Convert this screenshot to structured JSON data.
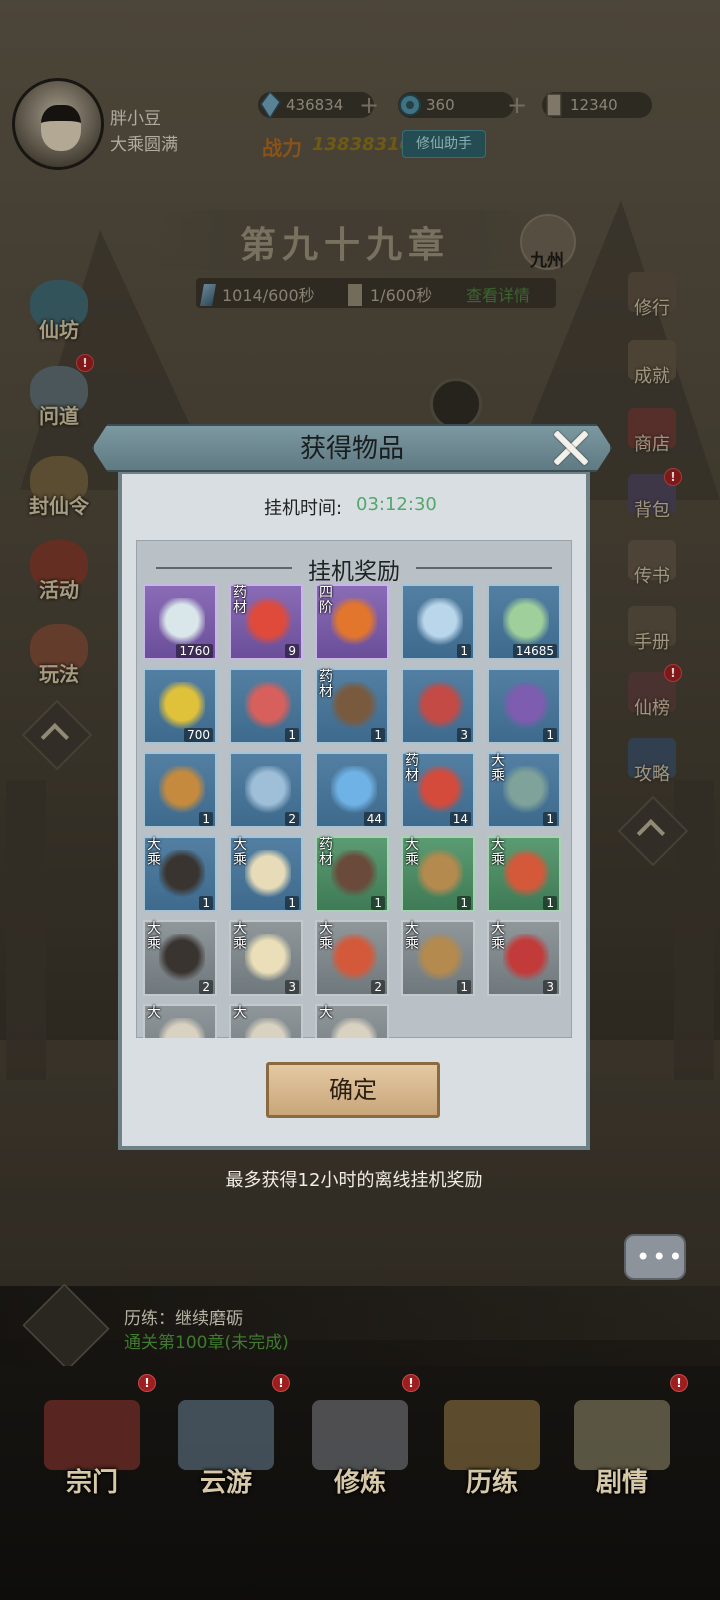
{
  "player": {
    "name": "胖小豆",
    "rank": "大乘圆满",
    "power_label": "战力",
    "power_value": "13838310",
    "helper_button": "修仙助手"
  },
  "resources": [
    {
      "name": "spirit-stone",
      "value": "436834"
    },
    {
      "name": "jade",
      "value": "360"
    },
    {
      "name": "scroll",
      "value": "12340"
    }
  ],
  "chapter": {
    "title": "第九十九章",
    "region": "九州",
    "rate_stone": "1014/600秒",
    "rate_scroll": "1/600秒",
    "details_link": "查看详情"
  },
  "left_menu": [
    {
      "label": "仙坊",
      "badge": ""
    },
    {
      "label": "问道",
      "badge": "!"
    },
    {
      "label": "封仙令",
      "badge": ""
    },
    {
      "label": "活动",
      "badge": ""
    },
    {
      "label": "玩法",
      "badge": ""
    }
  ],
  "right_menu": [
    {
      "label": "修行",
      "badge": ""
    },
    {
      "label": "成就",
      "badge": ""
    },
    {
      "label": "商店",
      "badge": ""
    },
    {
      "label": "背包",
      "badge": "!"
    },
    {
      "label": "传书",
      "badge": ""
    },
    {
      "label": "手册",
      "badge": ""
    },
    {
      "label": "仙榜",
      "badge": "!"
    },
    {
      "label": "攻略",
      "badge": ""
    }
  ],
  "modal": {
    "title": "获得物品",
    "idle_label": "挂机时间:",
    "idle_value": "03:12:30",
    "reward_heading": "挂机奖励",
    "confirm": "确定",
    "note": "最多获得12小时的离线挂机奖励"
  },
  "items": [
    {
      "icon": "spirit-orb-icon",
      "tag": "",
      "qty": "1760",
      "rarity": "purple",
      "color": "#d9e6ea"
    },
    {
      "icon": "fire-herb-icon",
      "tag": "药材",
      "qty": "9",
      "rarity": "purple",
      "color": "#e04a3a"
    },
    {
      "icon": "fire-rune-icon",
      "tag": "四阶",
      "qty": "",
      "rarity": "purple",
      "color": "#e3762d"
    },
    {
      "icon": "blue-crystal-icon",
      "tag": "",
      "qty": "1",
      "rarity": "blue",
      "color": "#b9d6ea"
    },
    {
      "icon": "green-swirl-icon",
      "tag": "",
      "qty": "14685",
      "rarity": "blue",
      "color": "#9fcf9a"
    },
    {
      "icon": "gold-powder-icon",
      "tag": "",
      "qty": "700",
      "rarity": "blue",
      "color": "#e0c13a"
    },
    {
      "icon": "red-crystal-cluster-icon",
      "tag": "",
      "qty": "1",
      "rarity": "blue",
      "color": "#d7605c"
    },
    {
      "icon": "wood-bark-icon",
      "tag": "药材",
      "qty": "1",
      "rarity": "blue",
      "color": "#7a5a3e"
    },
    {
      "icon": "red-shard-icon",
      "tag": "",
      "qty": "3",
      "rarity": "blue",
      "color": "#c44a45"
    },
    {
      "icon": "purple-gem-icon",
      "tag": "",
      "qty": "1",
      "rarity": "blue",
      "color": "#7e5cb0"
    },
    {
      "icon": "amber-stone-icon",
      "tag": "",
      "qty": "1",
      "rarity": "blue",
      "color": "#c58a3e"
    },
    {
      "icon": "ice-crystal-icon",
      "tag": "",
      "qty": "2",
      "rarity": "blue",
      "color": "#9fbfd8"
    },
    {
      "icon": "water-spirit-icon",
      "tag": "",
      "qty": "44",
      "rarity": "blue",
      "color": "#6fb3e6"
    },
    {
      "icon": "red-flower-icon",
      "tag": "药材",
      "qty": "14",
      "rarity": "blue",
      "color": "#d44b3c"
    },
    {
      "icon": "bronze-cauldron-icon",
      "tag": "大乘",
      "qty": "1",
      "rarity": "blue",
      "color": "#7fa39a"
    },
    {
      "icon": "black-robe-icon",
      "tag": "大乘",
      "qty": "1",
      "rarity": "blue",
      "color": "#3a3430"
    },
    {
      "icon": "mirror-icon",
      "tag": "大乘",
      "qty": "1",
      "rarity": "blue",
      "color": "#e8dcb8"
    },
    {
      "icon": "mushroom-icon",
      "tag": "药材",
      "qty": "1",
      "rarity": "green",
      "color": "#6a4a3a"
    },
    {
      "icon": "whip-icon",
      "tag": "大乘",
      "qty": "1",
      "rarity": "green",
      "color": "#b48a4e"
    },
    {
      "icon": "dragon-seal-icon",
      "tag": "大乘",
      "qty": "1",
      "rarity": "green",
      "color": "#d4593a"
    },
    {
      "icon": "black-robe-icon",
      "tag": "大乘",
      "qty": "2",
      "rarity": "gray",
      "color": "#3a3430"
    },
    {
      "icon": "talisman-scroll-icon",
      "tag": "大乘",
      "qty": "3",
      "rarity": "gray",
      "color": "#eadfb8"
    },
    {
      "icon": "dragon-seal-icon",
      "tag": "大乘",
      "qty": "2",
      "rarity": "gray",
      "color": "#d4593a"
    },
    {
      "icon": "whip-icon",
      "tag": "大乘",
      "qty": "1",
      "rarity": "gray",
      "color": "#b48a4e"
    },
    {
      "icon": "war-banner-icon",
      "tag": "大乘",
      "qty": "3",
      "rarity": "gray",
      "color": "#c23a3a"
    },
    {
      "icon": "partial-item-icon",
      "tag": "大",
      "qty": "",
      "rarity": "gray",
      "color": "#d9d2c0"
    },
    {
      "icon": "partial-item-icon",
      "tag": "大",
      "qty": "",
      "rarity": "gray",
      "color": "#d9d2c0"
    },
    {
      "icon": "partial-item-icon",
      "tag": "大",
      "qty": "",
      "rarity": "gray",
      "color": "#d9d2c0"
    }
  ],
  "quest": {
    "line1": "历练：继续磨砺",
    "line2": "通关第100章(未完成)"
  },
  "bottom_nav": [
    {
      "label": "宗门",
      "badge": "!"
    },
    {
      "label": "云游",
      "badge": "!"
    },
    {
      "label": "修炼",
      "badge": "!"
    },
    {
      "label": "历练",
      "badge": ""
    },
    {
      "label": "剧情",
      "badge": "!"
    }
  ]
}
